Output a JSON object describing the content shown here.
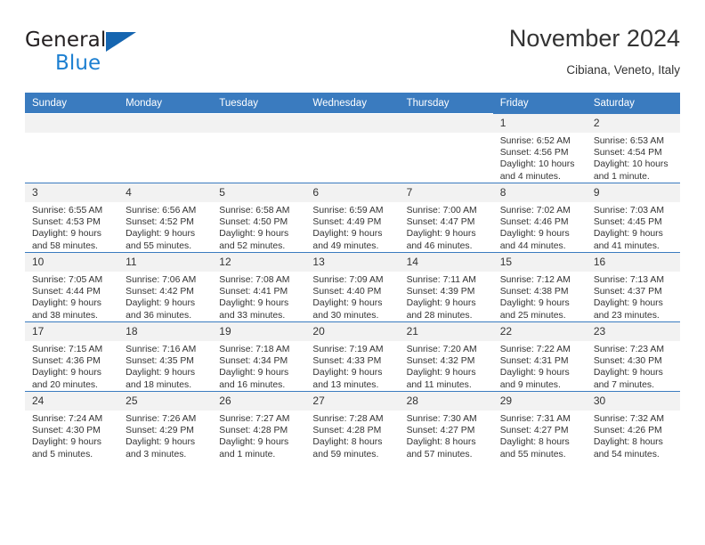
{
  "brand": {
    "name_top": "General",
    "name_bottom": "Blue",
    "accent_color": "#1c7fd1",
    "triangle_color": "#1565b0"
  },
  "header": {
    "title": "November 2024",
    "subtitle": "Cibiana, Veneto, Italy"
  },
  "calendar": {
    "header_bg": "#3a7bbf",
    "daynum_bg": "#f2f2f2",
    "weekdays": [
      "Sunday",
      "Monday",
      "Tuesday",
      "Wednesday",
      "Thursday",
      "Friday",
      "Saturday"
    ],
    "weeks": [
      [
        {
          "day": "",
          "lines": []
        },
        {
          "day": "",
          "lines": []
        },
        {
          "day": "",
          "lines": []
        },
        {
          "day": "",
          "lines": []
        },
        {
          "day": "",
          "lines": []
        },
        {
          "day": "1",
          "lines": [
            "Sunrise: 6:52 AM",
            "Sunset: 4:56 PM",
            "Daylight: 10 hours",
            "and 4 minutes."
          ]
        },
        {
          "day": "2",
          "lines": [
            "Sunrise: 6:53 AM",
            "Sunset: 4:54 PM",
            "Daylight: 10 hours",
            "and 1 minute."
          ]
        }
      ],
      [
        {
          "day": "3",
          "lines": [
            "Sunrise: 6:55 AM",
            "Sunset: 4:53 PM",
            "Daylight: 9 hours",
            "and 58 minutes."
          ]
        },
        {
          "day": "4",
          "lines": [
            "Sunrise: 6:56 AM",
            "Sunset: 4:52 PM",
            "Daylight: 9 hours",
            "and 55 minutes."
          ]
        },
        {
          "day": "5",
          "lines": [
            "Sunrise: 6:58 AM",
            "Sunset: 4:50 PM",
            "Daylight: 9 hours",
            "and 52 minutes."
          ]
        },
        {
          "day": "6",
          "lines": [
            "Sunrise: 6:59 AM",
            "Sunset: 4:49 PM",
            "Daylight: 9 hours",
            "and 49 minutes."
          ]
        },
        {
          "day": "7",
          "lines": [
            "Sunrise: 7:00 AM",
            "Sunset: 4:47 PM",
            "Daylight: 9 hours",
            "and 46 minutes."
          ]
        },
        {
          "day": "8",
          "lines": [
            "Sunrise: 7:02 AM",
            "Sunset: 4:46 PM",
            "Daylight: 9 hours",
            "and 44 minutes."
          ]
        },
        {
          "day": "9",
          "lines": [
            "Sunrise: 7:03 AM",
            "Sunset: 4:45 PM",
            "Daylight: 9 hours",
            "and 41 minutes."
          ]
        }
      ],
      [
        {
          "day": "10",
          "lines": [
            "Sunrise: 7:05 AM",
            "Sunset: 4:44 PM",
            "Daylight: 9 hours",
            "and 38 minutes."
          ]
        },
        {
          "day": "11",
          "lines": [
            "Sunrise: 7:06 AM",
            "Sunset: 4:42 PM",
            "Daylight: 9 hours",
            "and 36 minutes."
          ]
        },
        {
          "day": "12",
          "lines": [
            "Sunrise: 7:08 AM",
            "Sunset: 4:41 PM",
            "Daylight: 9 hours",
            "and 33 minutes."
          ]
        },
        {
          "day": "13",
          "lines": [
            "Sunrise: 7:09 AM",
            "Sunset: 4:40 PM",
            "Daylight: 9 hours",
            "and 30 minutes."
          ]
        },
        {
          "day": "14",
          "lines": [
            "Sunrise: 7:11 AM",
            "Sunset: 4:39 PM",
            "Daylight: 9 hours",
            "and 28 minutes."
          ]
        },
        {
          "day": "15",
          "lines": [
            "Sunrise: 7:12 AM",
            "Sunset: 4:38 PM",
            "Daylight: 9 hours",
            "and 25 minutes."
          ]
        },
        {
          "day": "16",
          "lines": [
            "Sunrise: 7:13 AM",
            "Sunset: 4:37 PM",
            "Daylight: 9 hours",
            "and 23 minutes."
          ]
        }
      ],
      [
        {
          "day": "17",
          "lines": [
            "Sunrise: 7:15 AM",
            "Sunset: 4:36 PM",
            "Daylight: 9 hours",
            "and 20 minutes."
          ]
        },
        {
          "day": "18",
          "lines": [
            "Sunrise: 7:16 AM",
            "Sunset: 4:35 PM",
            "Daylight: 9 hours",
            "and 18 minutes."
          ]
        },
        {
          "day": "19",
          "lines": [
            "Sunrise: 7:18 AM",
            "Sunset: 4:34 PM",
            "Daylight: 9 hours",
            "and 16 minutes."
          ]
        },
        {
          "day": "20",
          "lines": [
            "Sunrise: 7:19 AM",
            "Sunset: 4:33 PM",
            "Daylight: 9 hours",
            "and 13 minutes."
          ]
        },
        {
          "day": "21",
          "lines": [
            "Sunrise: 7:20 AM",
            "Sunset: 4:32 PM",
            "Daylight: 9 hours",
            "and 11 minutes."
          ]
        },
        {
          "day": "22",
          "lines": [
            "Sunrise: 7:22 AM",
            "Sunset: 4:31 PM",
            "Daylight: 9 hours",
            "and 9 minutes."
          ]
        },
        {
          "day": "23",
          "lines": [
            "Sunrise: 7:23 AM",
            "Sunset: 4:30 PM",
            "Daylight: 9 hours",
            "and 7 minutes."
          ]
        }
      ],
      [
        {
          "day": "24",
          "lines": [
            "Sunrise: 7:24 AM",
            "Sunset: 4:30 PM",
            "Daylight: 9 hours",
            "and 5 minutes."
          ]
        },
        {
          "day": "25",
          "lines": [
            "Sunrise: 7:26 AM",
            "Sunset: 4:29 PM",
            "Daylight: 9 hours",
            "and 3 minutes."
          ]
        },
        {
          "day": "26",
          "lines": [
            "Sunrise: 7:27 AM",
            "Sunset: 4:28 PM",
            "Daylight: 9 hours",
            "and 1 minute."
          ]
        },
        {
          "day": "27",
          "lines": [
            "Sunrise: 7:28 AM",
            "Sunset: 4:28 PM",
            "Daylight: 8 hours",
            "and 59 minutes."
          ]
        },
        {
          "day": "28",
          "lines": [
            "Sunrise: 7:30 AM",
            "Sunset: 4:27 PM",
            "Daylight: 8 hours",
            "and 57 minutes."
          ]
        },
        {
          "day": "29",
          "lines": [
            "Sunrise: 7:31 AM",
            "Sunset: 4:27 PM",
            "Daylight: 8 hours",
            "and 55 minutes."
          ]
        },
        {
          "day": "30",
          "lines": [
            "Sunrise: 7:32 AM",
            "Sunset: 4:26 PM",
            "Daylight: 8 hours",
            "and 54 minutes."
          ]
        }
      ]
    ]
  }
}
